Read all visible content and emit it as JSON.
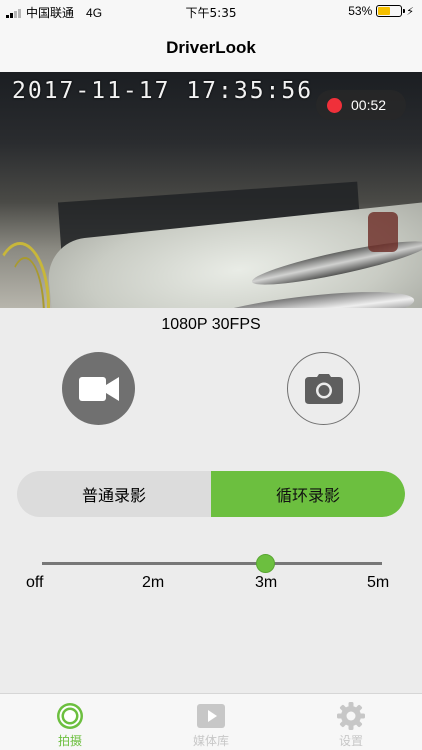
{
  "status_bar": {
    "carrier": "中国联通",
    "network": "4G",
    "time": "下午5:35",
    "battery": "53%",
    "battery_level": 0.53
  },
  "nav": {
    "title": "DriverLook"
  },
  "camera": {
    "timestamp": "2017-11-17  17:35:56",
    "recording_time": "00:52"
  },
  "resolution": "1080P 30FPS",
  "record_mode": {
    "options": [
      "普通录影",
      "循环录影"
    ],
    "selected": "循环录影"
  },
  "loop_slider": {
    "labels": [
      "off",
      "2m",
      "3m",
      "5m"
    ],
    "selected": "3m"
  },
  "tabs": [
    {
      "label": "拍摄",
      "active": true
    },
    {
      "label": "媒体库",
      "active": false
    },
    {
      "label": "设置",
      "active": false
    }
  ],
  "colors": {
    "accent": "#6cbf3f",
    "record": "#f0303a",
    "inactive": "#c7c7c7"
  }
}
